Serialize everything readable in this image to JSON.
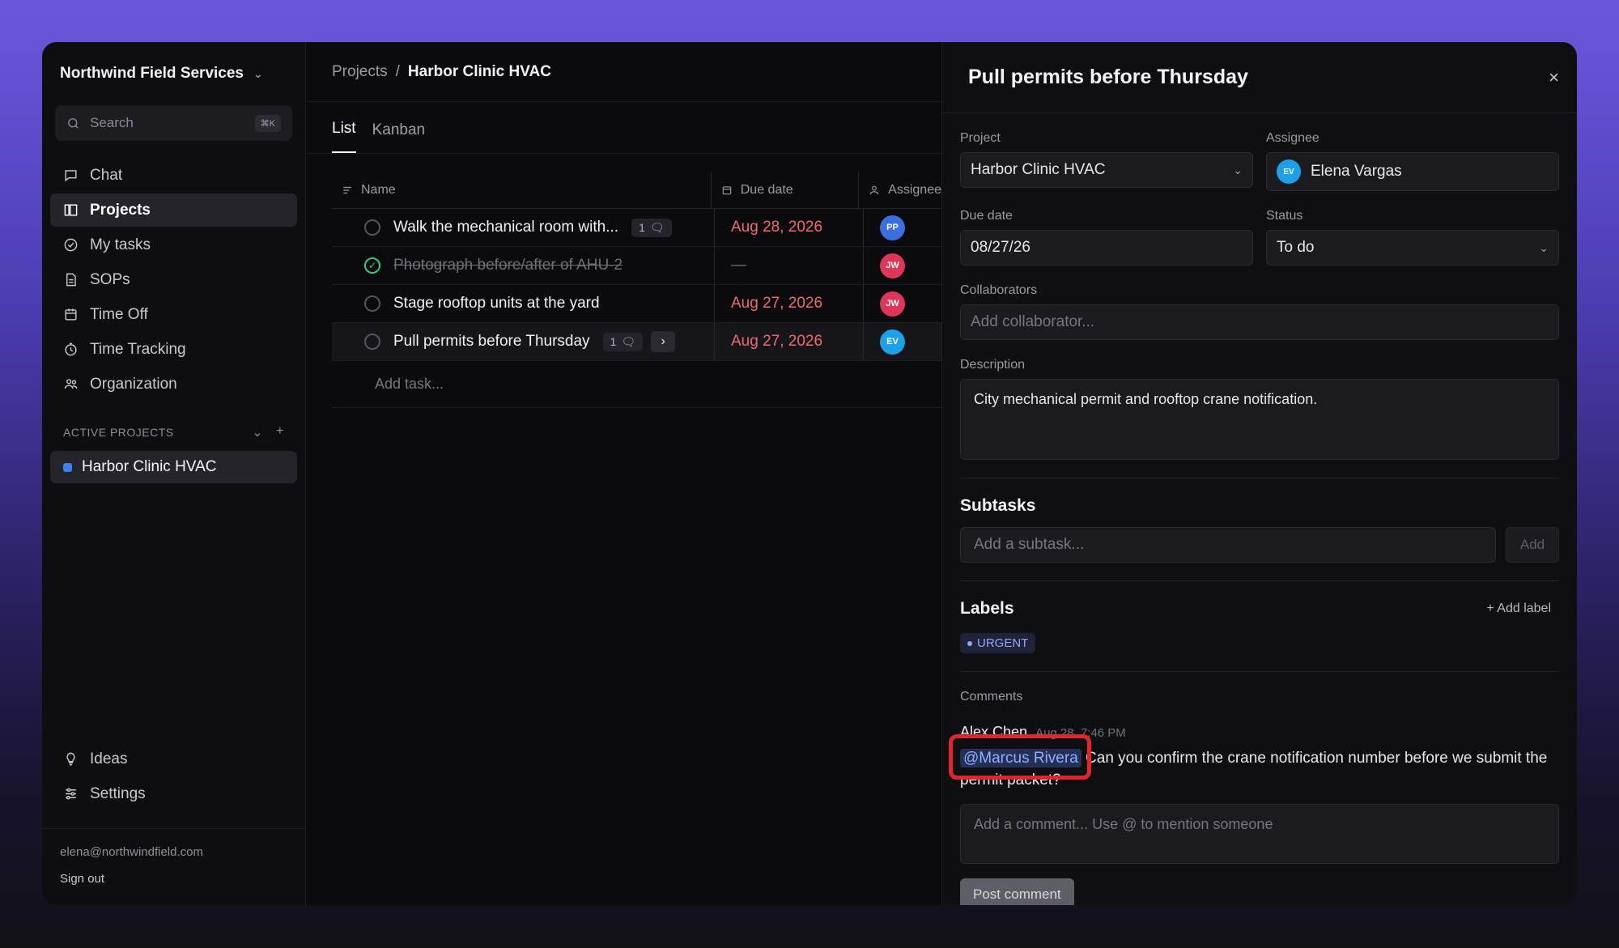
{
  "workspace": {
    "name": "Northwind Field Services"
  },
  "search": {
    "placeholder": "Search",
    "shortcut": "⌘K"
  },
  "nav": [
    {
      "label": "Chat",
      "icon": "chat-icon"
    },
    {
      "label": "Projects",
      "icon": "projects-icon",
      "active": true
    },
    {
      "label": "My tasks",
      "icon": "check-circle-icon"
    },
    {
      "label": "SOPs",
      "icon": "document-icon"
    },
    {
      "label": "Time Off",
      "icon": "calendar-icon"
    },
    {
      "label": "Time Tracking",
      "icon": "stopwatch-icon"
    },
    {
      "label": "Organization",
      "icon": "people-icon"
    }
  ],
  "active_projects": {
    "heading": "ACTIVE PROJECTS",
    "items": [
      {
        "label": "Harbor Clinic HVAC",
        "color": "#3b82f6"
      }
    ]
  },
  "bottom_nav": [
    {
      "label": "Ideas",
      "icon": "lightbulb-icon"
    },
    {
      "label": "Settings",
      "icon": "sliders-icon"
    }
  ],
  "account": {
    "email": "elena@northwindfield.com",
    "sign_out": "Sign out"
  },
  "breadcrumb": {
    "root": "Projects",
    "separator": "/",
    "current": "Harbor Clinic HVAC"
  },
  "tabs": [
    {
      "label": "List",
      "active": true
    },
    {
      "label": "Kanban"
    }
  ],
  "table": {
    "headers": {
      "name": "Name",
      "due": "Due date",
      "assignee": "Assignee"
    },
    "rows": [
      {
        "name": "Walk the mechanical room with...",
        "comments": "1",
        "due": "Aug 28, 2026",
        "assignee": "PP",
        "avatar_color": "#3b6fe0",
        "done": false
      },
      {
        "name": "Photograph before/after of AHU-2",
        "due": "—",
        "assignee": "JW",
        "avatar_color": "#e0355a",
        "done": true
      },
      {
        "name": "Stage rooftop units at the yard",
        "due": "Aug 27, 2026",
        "assignee": "JW",
        "avatar_color": "#e0355a",
        "done": false
      },
      {
        "name": "Pull permits before Thursday",
        "comments": "1",
        "due": "Aug 27, 2026",
        "assignee": "EV",
        "avatar_color": "#1ea0e8",
        "done": false,
        "selected": true
      }
    ],
    "add_task": "Add task..."
  },
  "detail": {
    "title": "Pull permits before Thursday",
    "project": {
      "label": "Project",
      "value": "Harbor Clinic HVAC"
    },
    "assignee": {
      "label": "Assignee",
      "value": "Elena Vargas",
      "initials": "EV"
    },
    "due_date": {
      "label": "Due date",
      "value": "08/27/26"
    },
    "status": {
      "label": "Status",
      "value": "To do"
    },
    "collaborators": {
      "label": "Collaborators",
      "placeholder": "Add collaborator..."
    },
    "description": {
      "label": "Description",
      "value": "City mechanical permit and rooftop crane notification."
    },
    "subtasks": {
      "title": "Subtasks",
      "placeholder": "Add a subtask...",
      "add_button": "Add"
    },
    "labels": {
      "title": "Labels",
      "add": "+ Add label",
      "items": [
        "URGENT"
      ]
    },
    "comments": {
      "label": "Comments",
      "items": [
        {
          "author": "Alex Chen",
          "time": "Aug 28, 7:46 PM",
          "mention": "@Marcus Rivera",
          "text": "Can you confirm the crane notification number before we submit the permit packet?"
        }
      ],
      "placeholder": "Add a comment... Use @ to mention someone",
      "post_button": "Post comment"
    }
  }
}
